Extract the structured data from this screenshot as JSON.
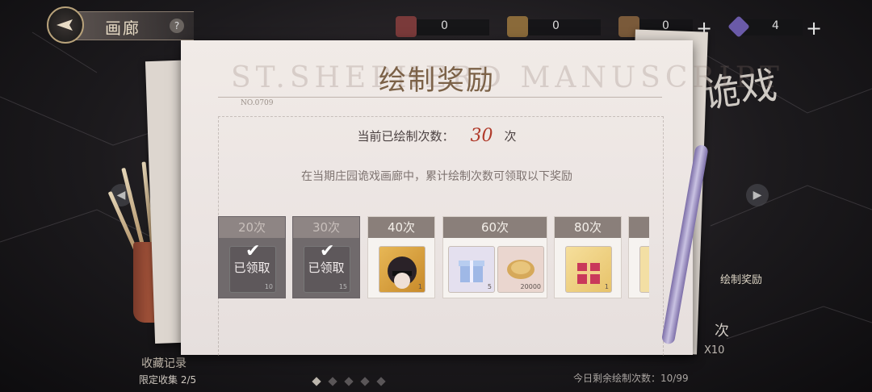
{
  "header": {
    "title": "画廊",
    "help": "?",
    "resources": [
      {
        "value": "0",
        "color": "#7a3a3a"
      },
      {
        "value": "0",
        "color": "#8a6a3a"
      },
      {
        "value": "0",
        "color": "#7a5a3a"
      },
      {
        "value": "4",
        "color": "#6a5aa8"
      }
    ],
    "plus": "+"
  },
  "background": {
    "side_text": "诡戏",
    "limited_collect": "限定收集  2/5",
    "record_label": "收藏记录",
    "draw_label": "绘制奖励",
    "draw_ci": "次",
    "draw_x10": "X10",
    "remaining": "今日剩余绘制次数：10/99",
    "arrow_left": "◀",
    "arrow_right": "▶"
  },
  "panel": {
    "watermark": "ST.SHEPHERD MANUSCRIPT",
    "title": "绘制奖励",
    "no": "NO.0709",
    "count_label": "当前已绘制次数：",
    "count_value": "30",
    "count_unit": "次",
    "description": "在当期庄园诡戏画廊中，累计绘制次数可领取以下奖励",
    "rewards": [
      {
        "label": "20次",
        "claimed": true,
        "claimed_text": "已领取",
        "qty": "10"
      },
      {
        "label": "30次",
        "claimed": true,
        "claimed_text": "已领取",
        "qty": "15"
      },
      {
        "label": "40次",
        "claimed": false,
        "qty": "1"
      },
      {
        "label": "60次",
        "claimed": false,
        "qty_a": "5",
        "qty_b": "20000"
      },
      {
        "label": "80次",
        "claimed": false,
        "qty": "1"
      }
    ]
  },
  "colors": {
    "accent": "#b03a2a",
    "paper": "#ebe4e2",
    "title": "#7c6248"
  }
}
